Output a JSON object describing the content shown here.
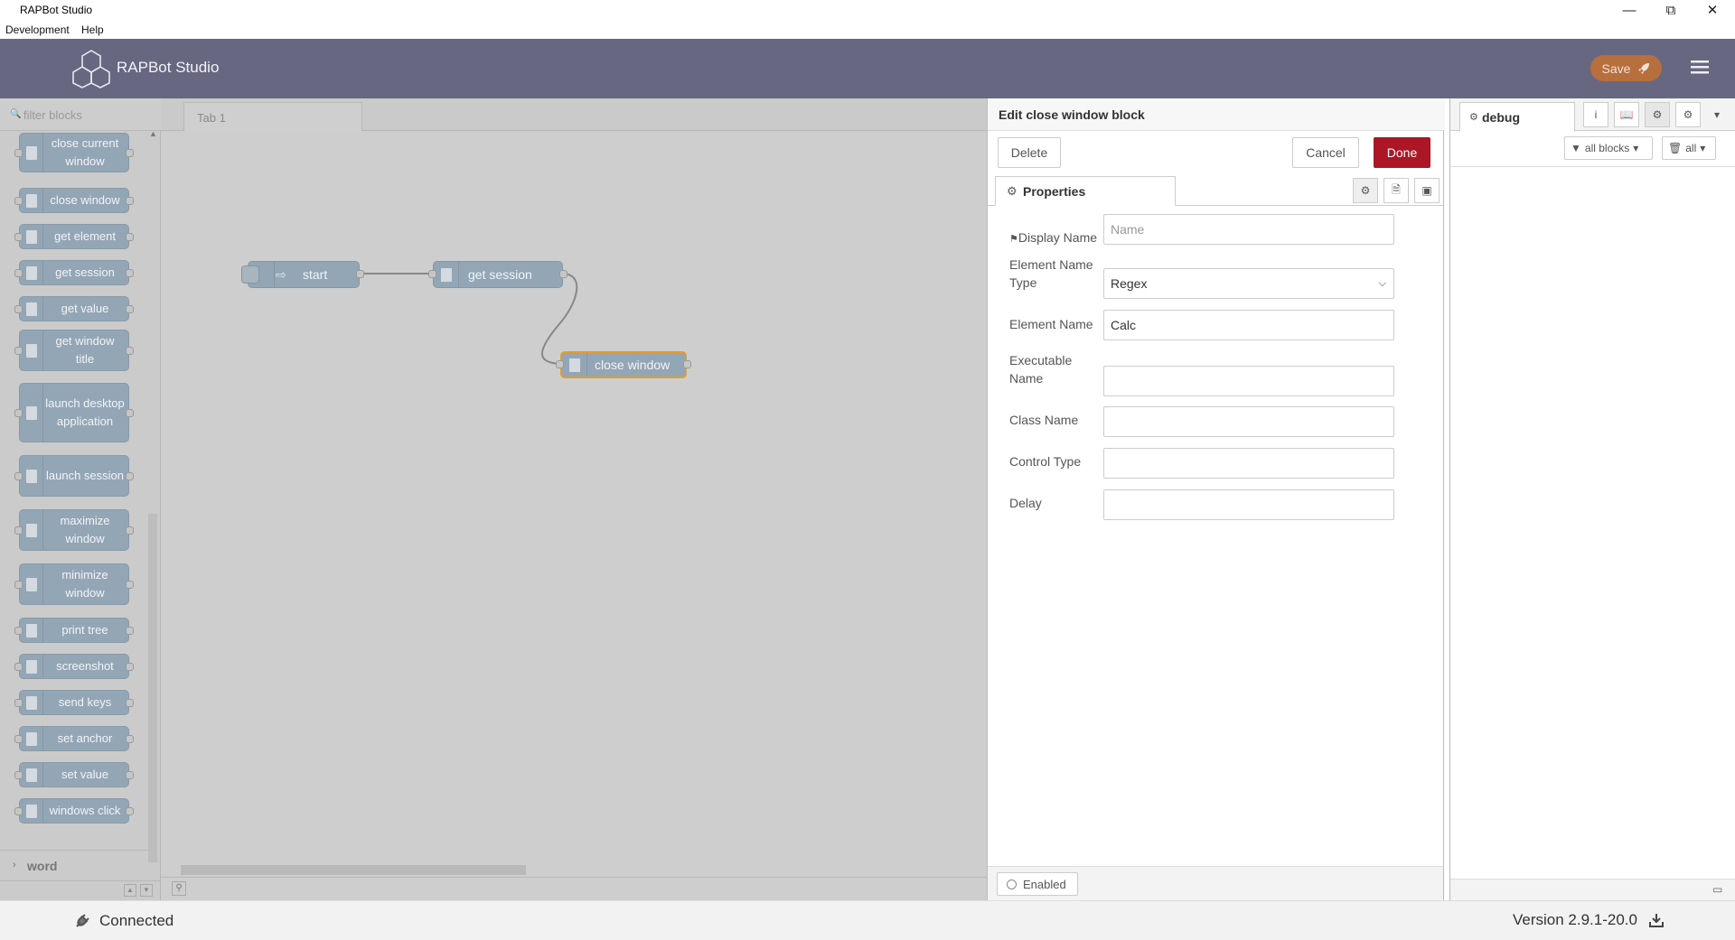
{
  "window": {
    "title": "RAPBot Studio",
    "controls": [
      "minimize-icon",
      "restore-icon",
      "close-icon"
    ]
  },
  "menubar": {
    "items": [
      "Development",
      "Help"
    ]
  },
  "header": {
    "app_name": "RAPBot Studio",
    "save_label": "Save",
    "colors": {
      "header_bg": "#676781",
      "save_bg": "#b86f3e"
    }
  },
  "palette": {
    "filter_placeholder": "filter blocks",
    "nodes": [
      "close current window",
      "close window",
      "get element",
      "get session",
      "get value",
      "get window title",
      "launch desktop application",
      "launch session",
      "maximize window",
      "minimize window",
      "print tree",
      "screenshot",
      "send keys",
      "set anchor",
      "set value",
      "windows click"
    ],
    "category": "word"
  },
  "workspace": {
    "tab_label": "Tab 1",
    "flow_nodes": {
      "start": "start",
      "get_session": "get session",
      "close_window": "close window"
    }
  },
  "tray": {
    "title": "Edit close window block",
    "delete_label": "Delete",
    "cancel_label": "Cancel",
    "done_label": "Done",
    "properties_tab": "Properties",
    "fields": {
      "display_name_label": "Display Name",
      "display_name_placeholder": "Name",
      "element_name_type_label": "Element Name Type",
      "element_name_type_value": "Regex",
      "element_name_label": "Element Name",
      "element_name_value": "Calc",
      "executable_name_label": "Executable Name",
      "class_name_label": "Class Name",
      "control_type_label": "Control Type",
      "delay_label": "Delay"
    },
    "enabled_label": "Enabled",
    "colors": {
      "done_bg": "#ad1625"
    }
  },
  "sidebar": {
    "tab_label": "debug",
    "filter_label": "all blocks",
    "clear_label": "all",
    "tab_icons": [
      "info-icon",
      "book-icon",
      "bug-icon",
      "gear-icon",
      "caret-down-icon"
    ]
  },
  "statusbar": {
    "connection": "Connected",
    "version": "Version 2.9.1-20.0"
  }
}
